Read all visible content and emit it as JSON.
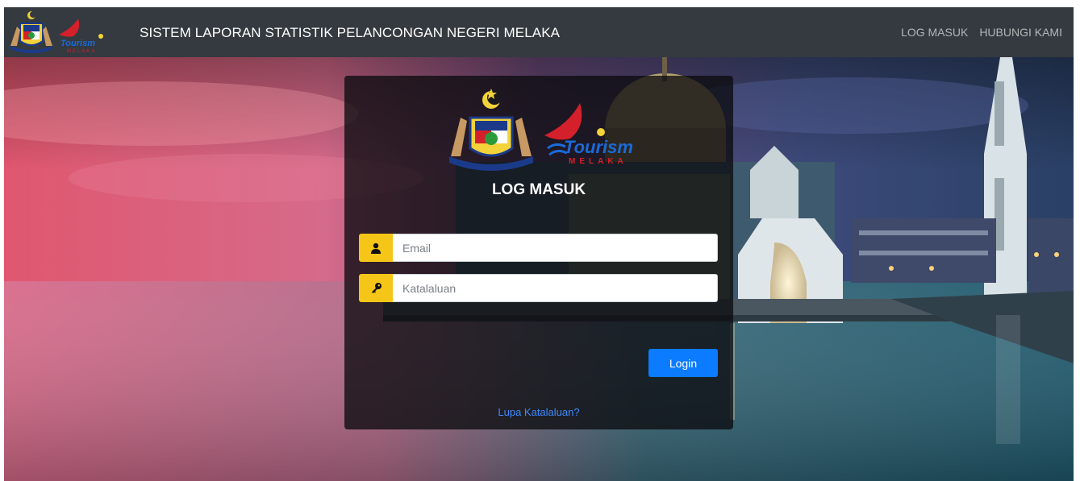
{
  "app": {
    "title": "SISTEM LAPORAN STATISTIK PELANCONGAN NEGERI MELAKA"
  },
  "nav": {
    "links": [
      "LOG MASUK",
      "HUBUNGI KAMI"
    ]
  },
  "login": {
    "title": "LOG MASUK",
    "email_placeholder": "Email",
    "password_placeholder": "Katalaluan",
    "submit_label": "Login",
    "forgot_label": "Lupa Katalaluan?"
  },
  "logos": {
    "tourism_text": "Tourism",
    "tourism_subtext": "MELAKA"
  },
  "icons": {
    "email": "user-icon",
    "password": "key-icon"
  },
  "colors": {
    "navbar": "#343a40",
    "icon_addon": "#f5c518",
    "button": "#0b7bff",
    "link": "#3d8bfd"
  }
}
